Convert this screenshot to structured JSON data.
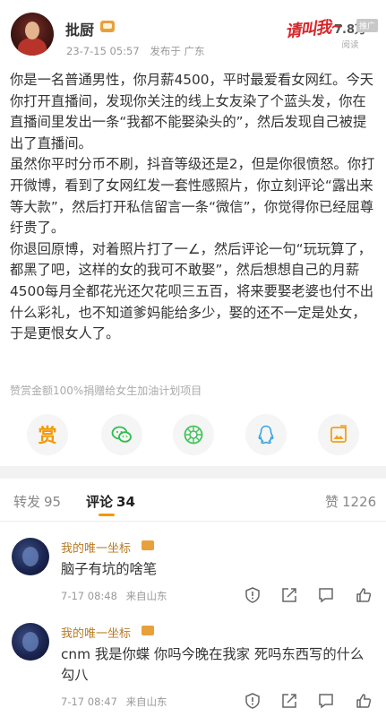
{
  "post": {
    "author": "批厨",
    "date": "23-7-15 05:57",
    "source": "发布于 广东",
    "ad_text": "请叫我~",
    "ad_tag": "推广",
    "views_count": "7.8万",
    "views_label": "阅读",
    "paragraphs": [
      "你是一名普通男性，你月薪4500，平时最爱看女网红。今天你打开直播间，发现你关注的线上女友染了个蓝头发，你在直播间里发出一条“我都不能娶染头的”，然后发现自己被提出了直播间。",
      "虽然你平时分币不刷，抖音等级还是2，但是你很愤怒。你打开微博，看到了女网红发一套性感照片，你立刻评论“露出来等大款”，然后打开私信留言一条“微信”，你觉得你已经屈尊纡贵了。",
      "你退回原博，对着照片打了一∠，然后评论一句“玩玩算了，都黑了吧，这样的女的我可不敢娶”，然后想想自己的月薪4500每月全都花光还欠花呗三五百，将来要娶老婆也付不出什么彩礼，也不知道爹妈能给多少，娶的还不一定是处女，于是更恨女人了。"
    ],
    "footnote": "赞赏金额100%捐赠给女生加油计划项目"
  },
  "share": {
    "items": [
      {
        "name": "reward-icon",
        "label": "赏"
      },
      {
        "name": "wechat-icon"
      },
      {
        "name": "moments-icon"
      },
      {
        "name": "qq-icon"
      },
      {
        "name": "save-image-icon"
      }
    ]
  },
  "tabs": {
    "repost_label": "转发",
    "repost_count": "95",
    "comment_label": "评论",
    "comment_count": "34",
    "like_label": "赞",
    "like_count": "1226"
  },
  "comments": [
    {
      "name": "我的唯一坐标",
      "text": "脑子有坑的啥笔",
      "time": "7-17 08:48",
      "location": "来自山东"
    },
    {
      "name": "我的唯一坐标",
      "text": "cnm 我是你蝶 你吗今晚在我家 死吗东西写的什么勾八",
      "time": "7-17 08:47",
      "location": "来自山东"
    }
  ],
  "colors": {
    "accent": "#f39800",
    "reward": "#f39800",
    "wechat": "#2fbf4f",
    "moments": "#43c55c",
    "qq": "#35a4e0",
    "save": "#f0a21b",
    "username": "#b77a23"
  }
}
